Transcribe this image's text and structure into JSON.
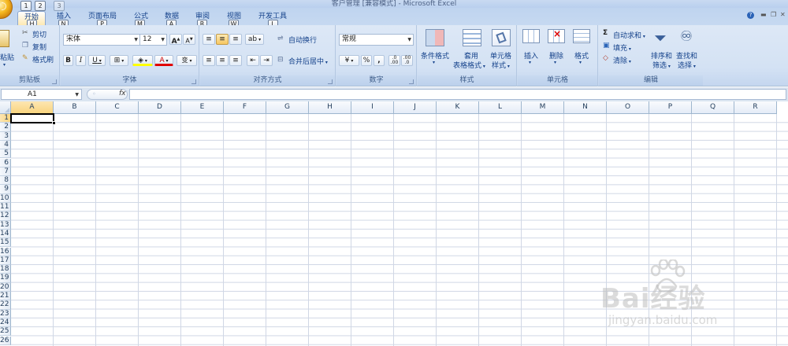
{
  "window": {
    "title": "客户管理  [兼容模式] - Microsoft Excel"
  },
  "quick_access": {
    "keytips": [
      "1",
      "2",
      "3"
    ]
  },
  "tabs": [
    {
      "label": "开始",
      "keytip": "H",
      "active": true
    },
    {
      "label": "插入",
      "keytip": "N"
    },
    {
      "label": "页面布局",
      "keytip": "P"
    },
    {
      "label": "公式",
      "keytip": "M"
    },
    {
      "label": "数据",
      "keytip": "A"
    },
    {
      "label": "审阅",
      "keytip": "R"
    },
    {
      "label": "视图",
      "keytip": "W"
    },
    {
      "label": "开发工具",
      "keytip": "L"
    }
  ],
  "ribbon": {
    "clipboard": {
      "group_label": "剪贴板",
      "paste": "粘贴",
      "cut": "剪切",
      "copy": "复制",
      "format_painter": "格式刷"
    },
    "font": {
      "group_label": "字体",
      "font_name": "宋体",
      "font_size": "12",
      "grow": "A",
      "shrink": "A",
      "bold": "B",
      "italic": "I",
      "underline": "U",
      "font_color_letter": "A",
      "phonetic": "wén"
    },
    "alignment": {
      "group_label": "对齐方式",
      "wrap_text": "自动换行",
      "merge_center": "合并后居中"
    },
    "number": {
      "group_label": "数字",
      "format": "常规",
      "percent": "%",
      "comma": ",",
      "inc_decimal": ".0 .00",
      "dec_decimal": ".00 .0"
    },
    "styles": {
      "group_label": "样式",
      "conditional_line1": "条件格式",
      "table_line1": "套用",
      "table_line2": "表格格式",
      "cell_styles_line1": "单元格",
      "cell_styles_line2": "样式"
    },
    "cells": {
      "group_label": "单元格",
      "insert": "插入",
      "delete": "删除",
      "format": "格式"
    },
    "editing": {
      "group_label": "编辑",
      "autosum": "自动求和",
      "fill": "填充",
      "clear": "清除",
      "sort_filter_line1": "排序和",
      "sort_filter_line2": "筛选",
      "find_select_line1": "查找和",
      "find_select_line2": "选择"
    }
  },
  "formula_bar": {
    "name_box": "A1",
    "fx": "fx",
    "formula": ""
  },
  "sheet": {
    "columns": [
      "A",
      "B",
      "C",
      "D",
      "E",
      "F",
      "G",
      "H",
      "I",
      "J",
      "K",
      "L",
      "M",
      "N",
      "O",
      "P",
      "Q",
      "R"
    ],
    "rows": [
      "1",
      "2",
      "3",
      "4",
      "5",
      "6",
      "7",
      "8",
      "9",
      "10",
      "11",
      "12",
      "13",
      "14",
      "15",
      "16",
      "17",
      "18",
      "19",
      "20",
      "21",
      "22",
      "23",
      "24",
      "25",
      "26"
    ],
    "active_cell": "A1"
  },
  "watermark": {
    "text": "Bai经验",
    "url": "jingyan.baidu.com"
  },
  "colors": {
    "ribbon_bg": "#d4e2f4",
    "tab_active": "#fde9b3",
    "header_selected": "#f9d47e",
    "gridline": "#d0d7e5"
  }
}
